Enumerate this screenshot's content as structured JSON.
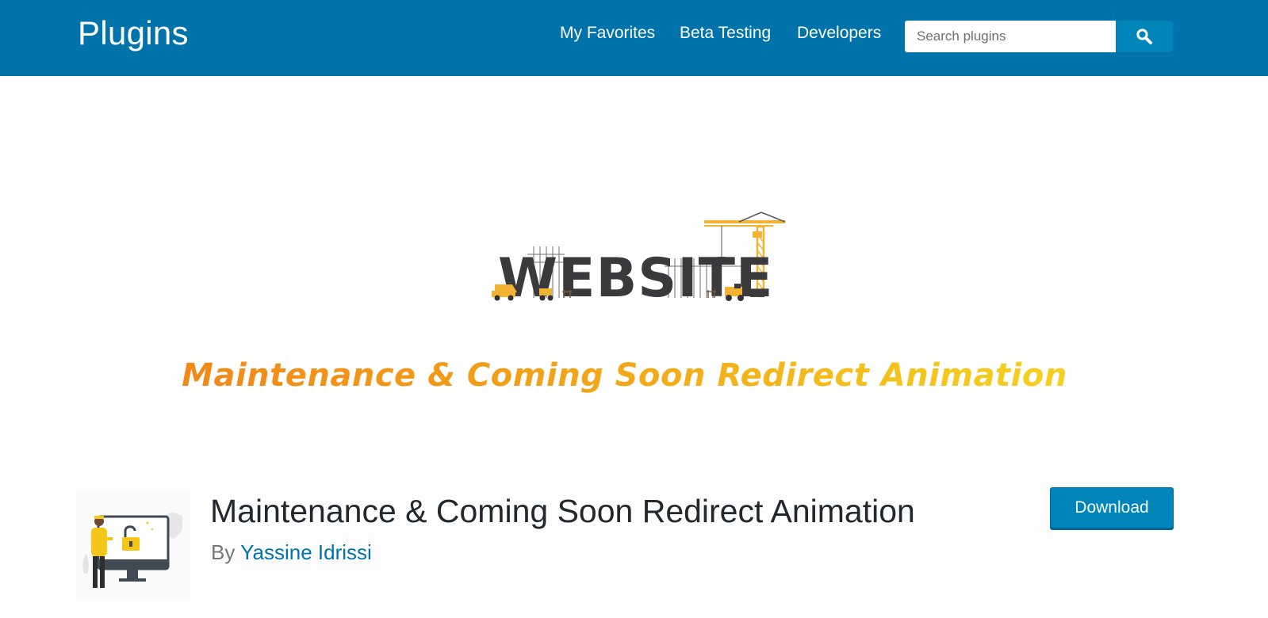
{
  "header": {
    "site_title": "Plugins",
    "nav": [
      {
        "label": "My Favorites"
      },
      {
        "label": "Beta Testing"
      },
      {
        "label": "Developers"
      }
    ],
    "search": {
      "placeholder": "Search plugins",
      "value": "",
      "button_icon": "search-icon"
    }
  },
  "banner": {
    "logo_text": "WEBSITE",
    "caption": "Maintenance & Coming Soon Redirect Animation"
  },
  "plugin": {
    "title": "Maintenance & Coming Soon Redirect Animation",
    "by_label": "By",
    "author": "Yassine Idrissi",
    "download_label": "Download"
  },
  "colors": {
    "header_bg": "#0073aa",
    "button_bg": "#0085ba",
    "link": "#0073aa",
    "caption_gradient": [
      "#f07c1a",
      "#f7de28"
    ]
  }
}
